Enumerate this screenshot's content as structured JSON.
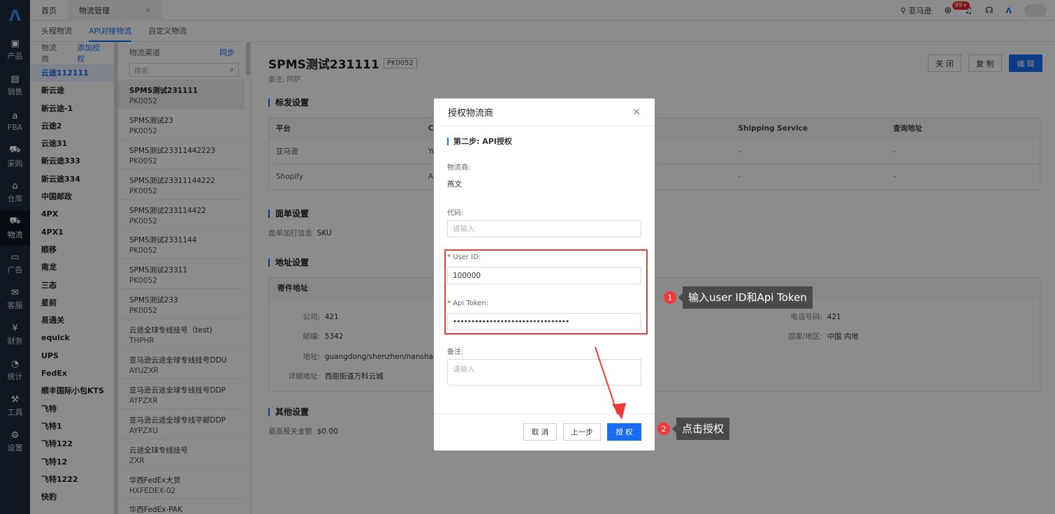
{
  "leftnav": {
    "items": [
      {
        "label": "产品",
        "icon": "bag-icon"
      },
      {
        "label": "销售",
        "icon": "store-icon"
      },
      {
        "label": "FBA",
        "icon": "amazon-icon"
      },
      {
        "label": "采购",
        "icon": "cart-icon"
      },
      {
        "label": "仓库",
        "icon": "warehouse-icon"
      },
      {
        "label": "物流",
        "icon": "truck-icon"
      },
      {
        "label": "广告",
        "icon": "ad-icon"
      },
      {
        "label": "客服",
        "icon": "message-icon"
      },
      {
        "label": "财务",
        "icon": "yen-icon"
      },
      {
        "label": "统计",
        "icon": "pie-chart-icon"
      },
      {
        "label": "工具",
        "icon": "wrench-icon"
      },
      {
        "label": "设置",
        "icon": "gear-icon"
      }
    ]
  },
  "topbar": {
    "tabs": [
      {
        "label": "首页"
      },
      {
        "label": "物流管理"
      }
    ],
    "close_glyph": "×",
    "shop": "亚马逊",
    "badge": "99+"
  },
  "subtabs": [
    {
      "label": "头程物流"
    },
    {
      "label": "API对接物流"
    },
    {
      "label": "自定义物流"
    }
  ],
  "col1": {
    "title": "物流商",
    "add_label": "添加授权",
    "carriers": [
      "云途112111",
      "新云途",
      "新云途-1",
      "云途2",
      "云途31",
      "新云途333",
      "新云途334",
      "中国邮政",
      "4PX",
      "4PX1",
      "顺移",
      "南龙",
      "三态",
      "星前",
      "易通关",
      "equick",
      "UPS",
      "FedEx",
      "顺丰国际小包KTS",
      "飞特",
      "飞特1",
      "飞特122",
      "飞特12",
      "飞特1222",
      "快豹"
    ]
  },
  "col2": {
    "title": "物流渠道",
    "sync_label": "同步",
    "search_placeholder": "搜索",
    "channels": [
      {
        "name": "SPMS测试231111",
        "code": "PK0052"
      },
      {
        "name": "SPMS测试23",
        "code": "PK0052"
      },
      {
        "name": "SPMS测试23311442223",
        "code": "PK0052"
      },
      {
        "name": "SPMS测试23311144222",
        "code": "PK0052"
      },
      {
        "name": "SPMS测试233114422",
        "code": "PK0052"
      },
      {
        "name": "SPMS测试2331144",
        "code": "PK0052"
      },
      {
        "name": "SPMS测试23311",
        "code": "PK0052"
      },
      {
        "name": "SPMS测试233",
        "code": "PK0052"
      },
      {
        "name": "云途全球专线挂号（test)",
        "code": "THPHR"
      },
      {
        "name": "亚马逊云途全球专线挂号DDU",
        "code": "AYUZXR"
      },
      {
        "name": "亚马逊云途全球专线挂号DDP",
        "code": "AYPZXR"
      },
      {
        "name": "亚马逊云途全球专线平邮DDP",
        "code": "AYPZXU"
      },
      {
        "name": "云途全球专线挂号",
        "code": "ZXR"
      },
      {
        "name": "华西FedEx大货",
        "code": "HXFEDEX-02"
      },
      {
        "name": "华西FedEx-PAK",
        "code": ""
      }
    ]
  },
  "main": {
    "title": "SPMS测试231111",
    "code": "PK0052",
    "remark": "备注:  阿萨",
    "buttons": {
      "close": "关 闭",
      "copy": "复 制",
      "edit": "编 辑"
    },
    "sections": {
      "label": "标发设置",
      "face": "面单设置",
      "address": "地址设置",
      "other": "其他设置"
    },
    "table": {
      "headers": [
        "平台",
        "Ca",
        "Shipping Service",
        "查询地址"
      ],
      "rows": [
        [
          "亚马逊",
          "Yu",
          "-",
          "-"
        ],
        [
          "Shopify",
          "Ar",
          "-",
          "-"
        ]
      ]
    },
    "face_print": {
      "label": "面单加打信息",
      "value": "SKU"
    },
    "address": {
      "head": "寄件地址",
      "company_label": "公司:",
      "company": "421",
      "zip_label": "邮编:",
      "zip": "5342",
      "addr_label": "地址:",
      "addr": "guangdong/shenzhen/nanshan",
      "detail_label": "详细地址:",
      "detail": "西丽街道万科云城",
      "phone_label": "电话号码:",
      "phone": "421",
      "country_label": "国家/地区:",
      "country": "中国 内地"
    },
    "other": {
      "label": "最高报关金额",
      "value": "$0.00"
    }
  },
  "modal": {
    "title": "授权物流商",
    "step": "第二步: API授权",
    "carrier_label": "物流商:",
    "carrier_value": "燕文",
    "code_label": "代码:",
    "code_placeholder": "请输入",
    "userid_label": "User ID:",
    "userid_value": "100000",
    "token_label": "Api Token:",
    "token_value": "••••••••••••••••••••••••••••••••",
    "note_label": "备注:",
    "note_placeholder": "请输入",
    "cancel": "取 消",
    "prev": "上一步",
    "authorize": "授 权"
  },
  "callouts": [
    {
      "num": "1",
      "text": "输入user ID和Api Token"
    },
    {
      "num": "2",
      "text": "点击授权"
    }
  ],
  "colors": {
    "accent": "#1a6cf2",
    "nav_bg": "#1f2a3c",
    "highlight": "#f03a3a"
  }
}
